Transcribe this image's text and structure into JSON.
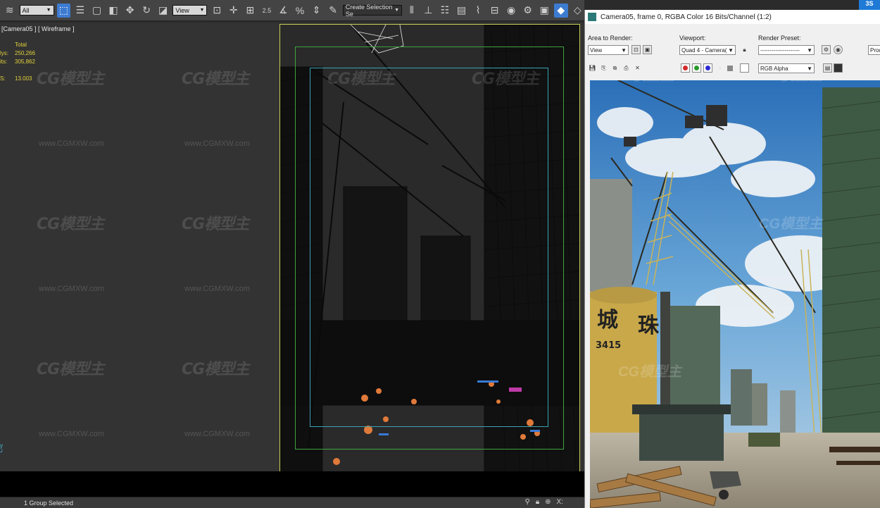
{
  "toolbar": {
    "selection_filter": "All",
    "ref_coord": "View",
    "named_selection_placeholder": "Create Selection Se",
    "snap_label": "2.5",
    "percent_label": "%"
  },
  "viewport": {
    "label": "[Camera05 ] [ Wireframe ]",
    "stats_header": "Total",
    "stats": [
      {
        "key": "lys:",
        "value": "250,266"
      },
      {
        "key": "its:",
        "value": "305,862"
      },
      {
        "key": "S:",
        "value": "13.003"
      }
    ]
  },
  "watermark": {
    "logo_text": "CG模型主",
    "url_text": "www.CGMXW.com"
  },
  "statusbar": {
    "message": "1 Group Selected",
    "x_label": "X:"
  },
  "frame_window": {
    "title": "Camera05, frame 0, RGBA Color 16 Bits/Channel (1:2)",
    "area_label": "Area to Render:",
    "viewport_label": "Viewport:",
    "preset_label": "Render Preset:",
    "area_value": "View",
    "viewport_value": "Quad 4 - Camera(",
    "preset_value": "---------------------",
    "production_value": "Prod",
    "channel_value": "RGB Alpha",
    "colors": {
      "red": "#d22a2a",
      "green": "#2a9a2a",
      "blue": "#2a2ad2"
    }
  },
  "render": {
    "sign_char_1": "城",
    "sign_char_2": "珠",
    "sign_number": "3415"
  },
  "corner_tab": "3S"
}
